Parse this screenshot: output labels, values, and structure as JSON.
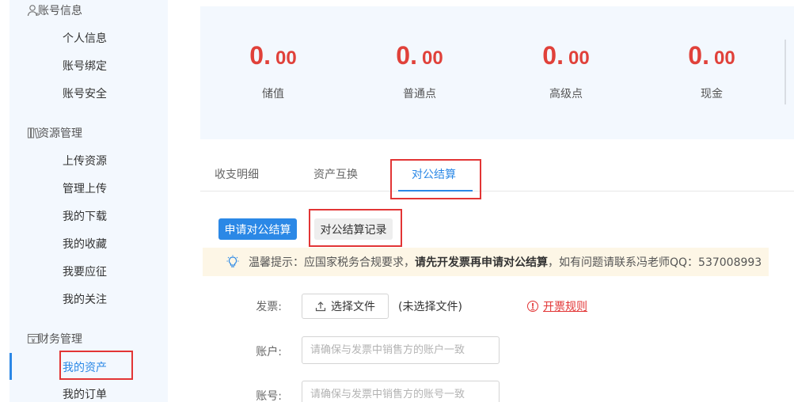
{
  "sidebar": {
    "sections": [
      {
        "title": "账号信息",
        "icon": "user-icon",
        "items": [
          "个人信息",
          "账号绑定",
          "账号安全"
        ]
      },
      {
        "title": "资源管理",
        "icon": "books-icon",
        "items": [
          "上传资源",
          "管理上传",
          "我的下载",
          "我的收藏",
          "我要应征",
          "我的关注"
        ]
      },
      {
        "title": "财务管理",
        "icon": "wallet-icon",
        "items": [
          "我的资产",
          "我的订单"
        ]
      }
    ],
    "active_item": "我的资产"
  },
  "stats": [
    {
      "int": "0.",
      "dec": "00",
      "label": "储值"
    },
    {
      "int": "0.",
      "dec": "00",
      "label": "普通点"
    },
    {
      "int": "0.",
      "dec": "00",
      "label": "高级点"
    },
    {
      "int": "0.",
      "dec": "00",
      "label": "现金"
    }
  ],
  "tabs": [
    "收支明细",
    "资产互换",
    "对公结算"
  ],
  "active_tab": "对公结算",
  "sub_buttons": {
    "apply": "申请对公结算",
    "records": "对公结算记录"
  },
  "notice": {
    "prefix": "温馨提示：应国家税务合规要求，",
    "bold": "请先开发票再申请对公结算",
    "suffix": "，如有问题请联系冯老师QQ：537008993"
  },
  "form": {
    "invoice_label": "发票:",
    "upload_label": "选择文件",
    "no_file": "(未选择文件)",
    "rule_link": "开票规则",
    "account_label": "账户:",
    "account_placeholder": "请确保与发票中销售方的账户一致",
    "number_label": "账号:",
    "number_placeholder": "请确保与发票中销售方的账号一致"
  },
  "colors": {
    "accent": "#2b88e6",
    "amount": "#e0413a",
    "highlight": "#e23535",
    "panel": "#f3f8fe",
    "notice_bg": "#fdf6e6"
  }
}
